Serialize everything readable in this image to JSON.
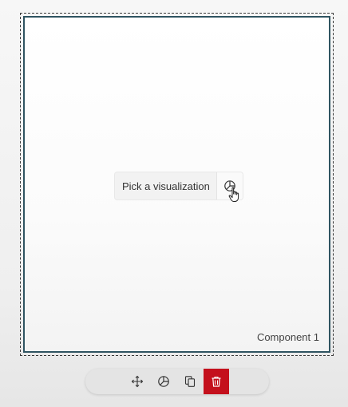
{
  "component": {
    "label": "Component 1"
  },
  "placeholder": {
    "text": "Pick a visualization",
    "icon": "chart-pie-icon"
  },
  "toolbar": {
    "move_icon": "move-icon",
    "visualization_icon": "chart-pie-icon",
    "copy_icon": "copy-icon",
    "delete_icon": "trash-icon"
  },
  "colors": {
    "frame_border": "#2f5461",
    "delete_accent": "#c4101c"
  }
}
